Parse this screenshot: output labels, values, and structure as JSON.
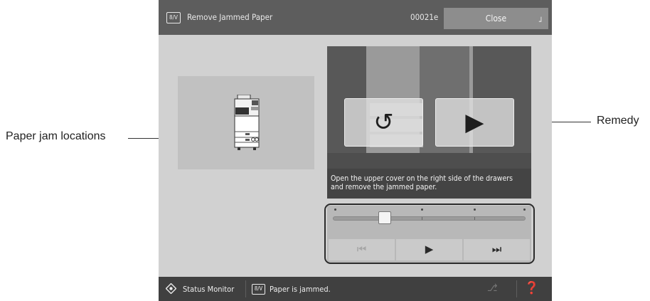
{
  "callouts": {
    "left": "Paper jam locations",
    "right": "Remedy"
  },
  "titlebar": {
    "icon_text": "8/V",
    "title": "Remove Jammed Paper",
    "code": "00021e",
    "close_label": "Close"
  },
  "video": {
    "caption": "Open the upper cover on the right side of the drawers and remove the jammed paper."
  },
  "player": {
    "position": 0.27,
    "chapter_markers": 4,
    "prev_label": "⏮",
    "play_label": "▶",
    "next_label": "⏭"
  },
  "statusbar": {
    "monitor_label": "Status Monitor",
    "icon_text": "8/V",
    "message": "Paper is jammed."
  },
  "colors": {
    "titlebar": "#5d5d5d",
    "statusbar": "#404040",
    "screen_bg": "#d1d1d1"
  }
}
